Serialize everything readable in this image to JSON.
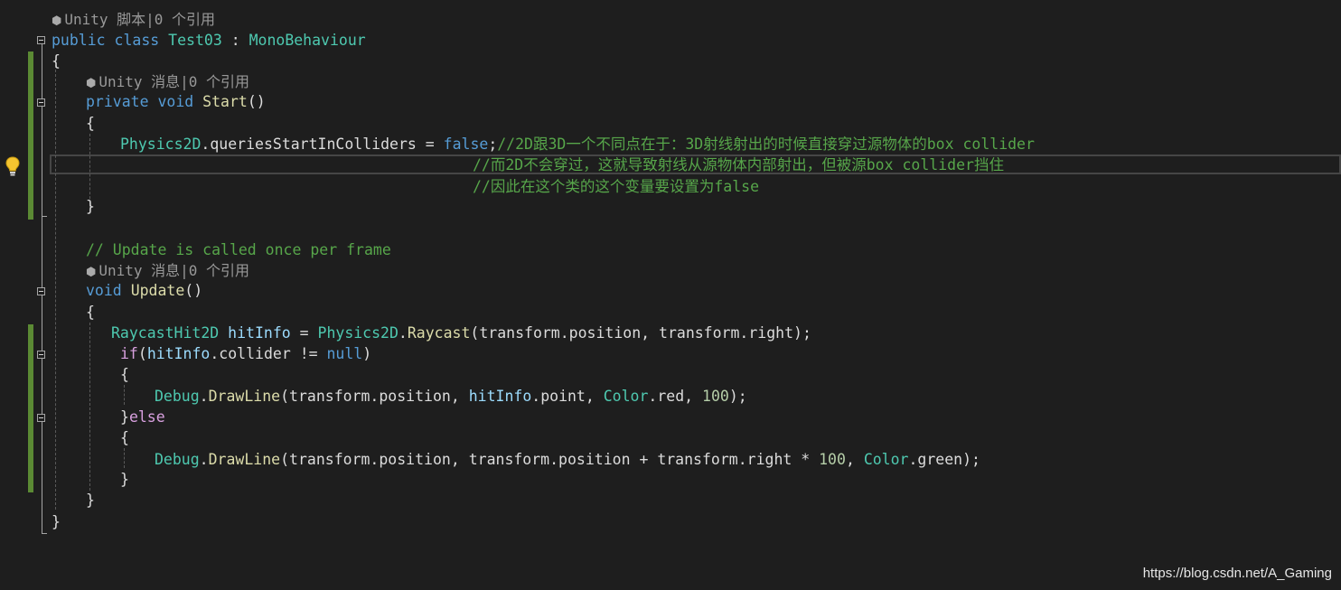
{
  "codelens": {
    "class_refs": "Unity 脚本|0 个引用",
    "start_refs": "Unity 消息|0 个引用",
    "update_refs": "Unity 消息|0 个引用"
  },
  "code": {
    "l2_kw1": "public",
    "l2_kw2": "class",
    "l2_name": "Test03",
    "l2_colon": " : ",
    "l2_base": "MonoBehaviour",
    "brace_open": "{",
    "brace_close": "}",
    "l5_kw1": "private",
    "l5_kw2": "void",
    "l5_name": "Start",
    "parens": "()",
    "l7_type": "Physics2D",
    "l7_dot": ".",
    "l7_prop": "queriesStartInColliders",
    "l7_eq": " = ",
    "l7_false": "false",
    "l7_semi": ";",
    "l7_comment": "//2D跟3D一个不同点在于：3D射线射出的时候直接穿过源物体的box collider",
    "l8_comment": "//而2D不会穿过，这就导致射线从源物体内部射出，但被源box collider挡住",
    "l9_comment": "//因此在这个类的这个变量要设置为false",
    "l11_comment": "// Update is called once per frame",
    "l13_kw": "void",
    "l13_name": "Update",
    "l15_type": "RaycastHit2D",
    "l15_var": "hitInfo",
    "l15_eq": " = ",
    "l15_type2": "Physics2D",
    "l15_dot": ".",
    "l15_fn": "Raycast",
    "l15_args": "(transform.position, transform.right);",
    "l16_if": "if",
    "l16_open": "(",
    "l16_var": "hitInfo",
    "l16_mid": ".collider != ",
    "l16_null": "null",
    "l16_close": ")",
    "debug": "Debug",
    "dot": ".",
    "drawline": "DrawLine",
    "l18_args1": "(transform.position, ",
    "l18_var": "hitInfo",
    "l18_args2": ".point, ",
    "color": "Color",
    "l18_red": ".red, ",
    "l18_num": "100",
    "l18_end": ");",
    "l19_else": "else",
    "l21_args": "(transform.position, transform.position + transform.right * ",
    "l21_num": "100",
    "l21_comma": ", ",
    "l21_green": ".green);"
  },
  "watermark": "https://blog.csdn.net/A_Gaming",
  "colors": {
    "background": "#1e1e1e",
    "keyword": "#569cd6",
    "type": "#4ec9b0",
    "method": "#dcdcaa",
    "variable": "#9cdcfe",
    "number": "#b5cea8",
    "comment": "#57a64a",
    "control": "#d8a0df",
    "change_bar": "#5b8a34"
  },
  "icons": {
    "lightbulb": "lightbulb-icon",
    "codelens": "unity-cube-icon",
    "fold": "collapse-icon"
  }
}
